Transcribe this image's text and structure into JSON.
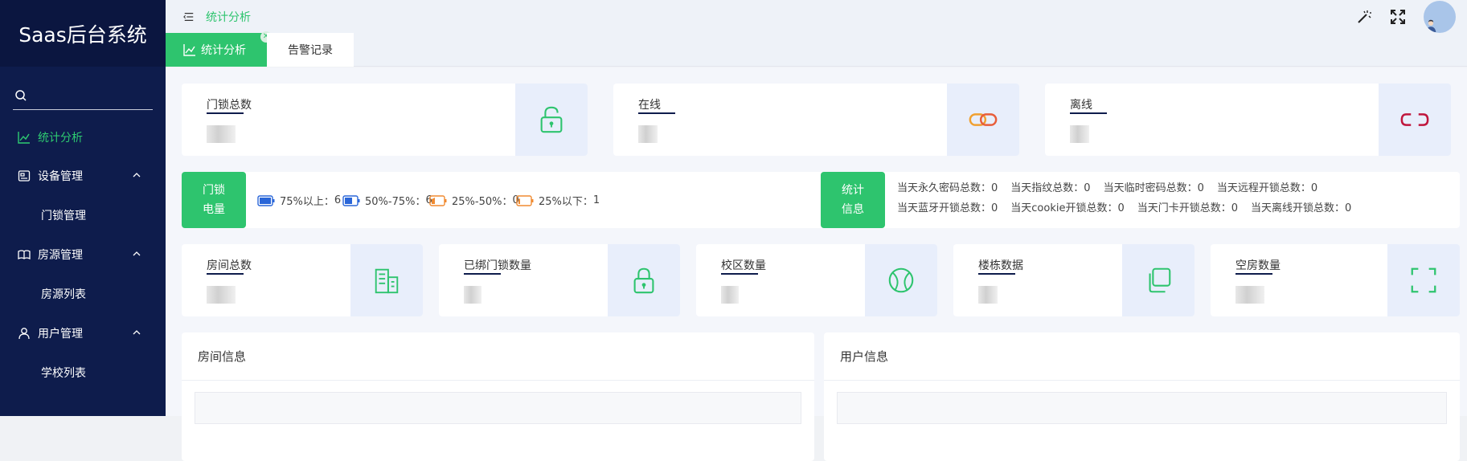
{
  "app": {
    "title": "Saas后台系统"
  },
  "search": {
    "placeholder": ""
  },
  "sidebar": {
    "items": [
      {
        "label": "统计分析",
        "active": true
      },
      {
        "label": "设备管理",
        "children": [
          "门锁管理"
        ]
      },
      {
        "label": "房源管理",
        "children": [
          "房源列表"
        ]
      },
      {
        "label": "用户管理",
        "children": [
          "学校列表"
        ]
      }
    ]
  },
  "breadcrumb": {
    "current": "统计分析"
  },
  "tabs": [
    {
      "label": "统计分析"
    },
    {
      "label": "告警记录"
    }
  ],
  "top_cards": [
    {
      "label": "门锁总数"
    },
    {
      "label": "在线"
    },
    {
      "label": "离线"
    }
  ],
  "battery": {
    "title_line1": "门锁",
    "title_line2": "电量",
    "levels": [
      {
        "label": "75%以上：",
        "count": "6"
      },
      {
        "label": "50%-75%：",
        "count": "6"
      },
      {
        "label": "25%-50%：",
        "count": "0"
      },
      {
        "label": "25%以下：",
        "count": "1"
      }
    ]
  },
  "stats": {
    "title_line1": "统计",
    "title_line2": "信息",
    "row1": [
      "当天永久密码总数：0",
      "当天指纹总数：0",
      "当天临时密码总数：0",
      "当天远程开锁总数：0"
    ],
    "row2": [
      "当天蓝牙开锁总数：0",
      "当天cookie开锁总数：0",
      "当天门卡开锁总数：0",
      "当天离线开锁总数：0"
    ]
  },
  "mid_cards": [
    {
      "label": "房间总数"
    },
    {
      "label": "已绑门锁数量"
    },
    {
      "label": "校区数量"
    },
    {
      "label": "楼栋数据"
    },
    {
      "label": "空房数量"
    }
  ],
  "panels": {
    "room": "房间信息",
    "user": "用户信息"
  },
  "colors": {
    "accent": "#2ec46e",
    "sidebar": "#0e1c4c",
    "offline": "#c0163c",
    "online": "#f0a030"
  }
}
